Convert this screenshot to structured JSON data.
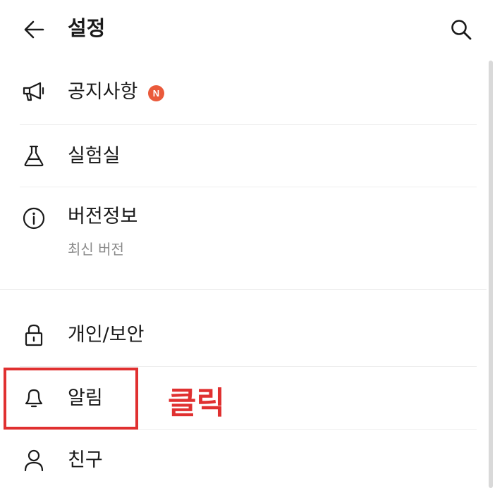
{
  "header": {
    "title": "설정",
    "back_icon": "arrow-left-icon",
    "search_icon": "search-icon"
  },
  "menu": {
    "notices": {
      "label": "공지사항",
      "badge": "N",
      "icon": "megaphone-icon",
      "badge_color": "#ea5a3b"
    },
    "labs": {
      "label": "실험실",
      "icon": "flask-icon"
    },
    "version": {
      "label": "버전정보",
      "sub": "최신 버전",
      "icon": "info-icon"
    },
    "privacy": {
      "label": "개인/보안",
      "icon": "lock-icon"
    },
    "notifications": {
      "label": "알림",
      "icon": "bell-icon"
    },
    "friends": {
      "label": "친구",
      "icon": "person-icon"
    }
  },
  "annotation": {
    "text": "클릭",
    "color": "#e03030"
  }
}
